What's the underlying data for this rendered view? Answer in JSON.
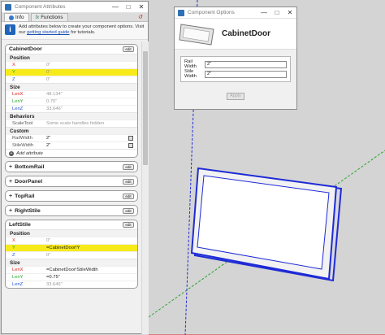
{
  "component_attributes": {
    "title": "Component Attributes",
    "window_buttons": [
      "—",
      "□",
      "✕"
    ],
    "tabs": [
      {
        "label": "Info"
      },
      {
        "label": "Functions"
      }
    ],
    "reload_glyph": "↺",
    "intro": {
      "line1": "Add attributes below to create your component options. Visit",
      "line2_prefix": "our ",
      "link": "getting started guide",
      "line2_suffix": " for tutorials."
    },
    "edit_label": "edit",
    "add_attribute": "Add attribute",
    "panels": [
      {
        "name": "CabinetDoor",
        "position": {
          "label": "Position",
          "x": {
            "k": "X",
            "v": "0\""
          },
          "y": {
            "k": "Y",
            "v": "0\""
          },
          "z": {
            "k": "Z",
            "v": "0\""
          }
        },
        "size": {
          "label": "Size",
          "lenx": {
            "k": "LenX",
            "v": "48.134\""
          },
          "leny": {
            "k": "LenY",
            "v": "0.75\""
          },
          "lenz": {
            "k": "LenZ",
            "v": "33.646\""
          }
        },
        "behaviors": {
          "label": "Behaviors",
          "scaletool": {
            "k": "ScaleTool",
            "v": "Some scale handles hidden"
          }
        },
        "custom": {
          "label": "Custom",
          "railwidth": {
            "k": "RailWidth",
            "v": "2\""
          },
          "stilewidth": {
            "k": "StileWidth",
            "v": "2\""
          }
        }
      },
      {
        "name": "BottomRail"
      },
      {
        "name": "DoorPanel"
      },
      {
        "name": "TopRail"
      },
      {
        "name": "RightStile"
      },
      {
        "name": "LeftStile",
        "position": {
          "label": "Position",
          "x": {
            "k": "X",
            "v": "0\""
          },
          "y": {
            "k": "Y",
            "v": "=CabinetDoor!Y"
          },
          "z": {
            "k": "Z",
            "v": "0\""
          }
        },
        "size": {
          "label": "Size",
          "lenx": {
            "k": "LenX",
            "v": "=CabinetDoor!StileWidth"
          },
          "leny": {
            "k": "LenY",
            "v": "=0.75\""
          },
          "lenz": {
            "k": "LenZ",
            "v": "33.646\""
          }
        }
      }
    ]
  },
  "component_options": {
    "title": "Component Options",
    "window_buttons": [
      "—",
      "□",
      "✕"
    ],
    "component_name": "CabinetDoor",
    "rail_width": {
      "label": "Rail Width",
      "value": "2\""
    },
    "stile_width": {
      "label": "Stile Width",
      "value": "2\""
    },
    "apply_label": "Apply"
  },
  "colors": {
    "highlight": "#f7ea1a",
    "axis_red": "#d22222",
    "axis_green": "#22aa22",
    "axis_blue": "#2222dd",
    "selection_blue": "#1e2bd6"
  }
}
